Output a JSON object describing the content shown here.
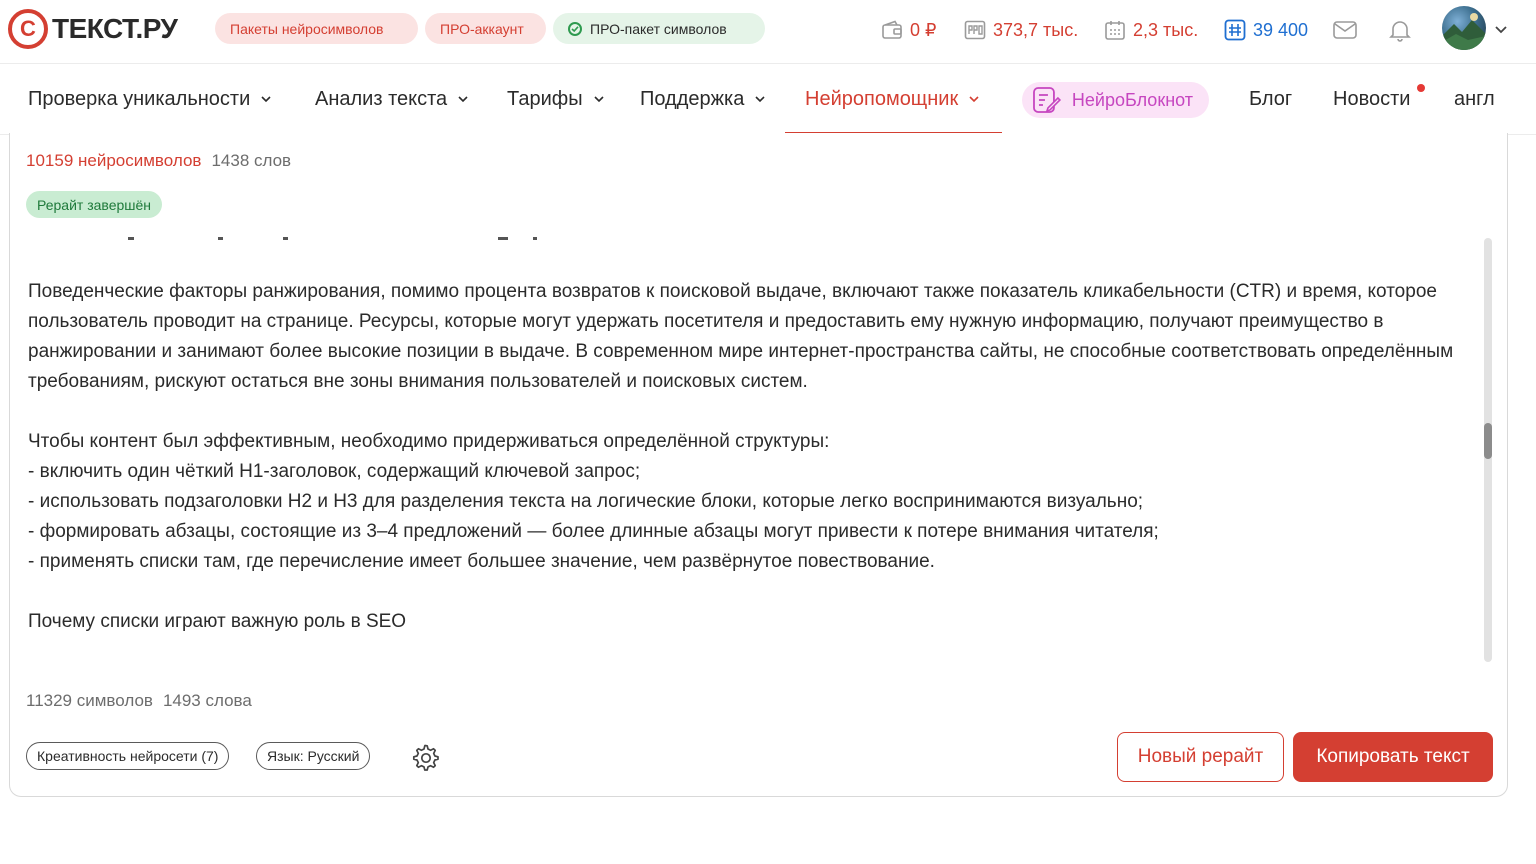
{
  "header": {
    "logo_text": "ТЕКСТ.РУ",
    "logo_mark": "С",
    "pills": {
      "packages": "Пакеты нейросимволов",
      "pro_account": "ПРО-аккаунт",
      "pro_package": "ПРО-пакет символов"
    },
    "stats": {
      "balance": "0 ₽",
      "pro_symbols": "373,7 тыс.",
      "daily": "2,3 тыс.",
      "neuro": "39 400"
    },
    "icons": {
      "wallet": "wallet-icon",
      "pro": "pro-icon",
      "calendar": "calendar-icon",
      "neuro": "neuro-symbols-icon",
      "mail": "mail-icon",
      "bell": "bell-icon"
    }
  },
  "nav": {
    "items": [
      {
        "label": "Проверка уникальности"
      },
      {
        "label": "Анализ текста"
      },
      {
        "label": "Тарифы"
      },
      {
        "label": "Поддержка"
      },
      {
        "label": "Нейропомощник"
      }
    ],
    "neuro_notebook": "НейроБлокнот",
    "blog": "Блог",
    "news": "Новости",
    "lang": "англ"
  },
  "editor": {
    "neuro_symbols": "10159 нейросимволов",
    "words_top": "1438 слов",
    "status": "Рерайт завершён",
    "paragraphs": [
      "Поведенческие факторы ранжирования, помимо процента возвратов к поисковой выдаче, включают также показатель кликабельности (CTR) и время, которое пользователь проводит на странице. Ресурсы, которые могут удержать посетителя и предоставить ему нужную информацию, получают преимущество в ранжировании и занимают более высокие позиции в выдаче. В современном мире интернет-пространства сайты, не способные соответствовать определённым требованиям, рискуют остаться вне зоны внимания пользователей и поисковых систем.",
      "Чтобы контент был эффективным, необходимо придерживаться определённой структуры:",
      "- включить один чёткий H1-заголовок, содержащий ключевой запрос;",
      "- использовать подзаголовки H2 и H3 для разделения текста на логические блоки, которые легко воспринимаются визуально;",
      "- формировать абзацы, состоящие из 3–4 предложений — более длинные абзацы могут привести к потере внимания читателя;",
      "- применять списки там, где перечисление имеет большее значение, чем развёрнутое повествование.",
      "Почему списки играют важную роль в SEO"
    ],
    "chars_bottom": "11329 символов",
    "words_bottom": "1493 слова",
    "chip_creativity": "Креативность нейросети (7)",
    "chip_language": "Язык: Русский",
    "new_rewrite": "Новый рерайт",
    "copy_text": "Копировать текст"
  },
  "colors": {
    "accent": "#d43f32",
    "blue": "#1f6fd1",
    "success_bg": "#c9ecd2",
    "pink": "#c646c0"
  }
}
